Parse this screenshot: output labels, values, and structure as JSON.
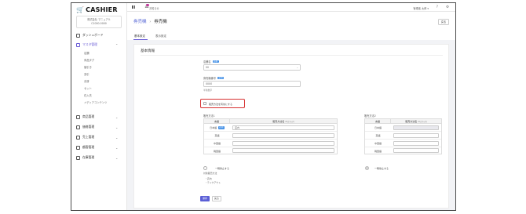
{
  "app": {
    "logo": "CASHIER",
    "logo_mark": "🛒"
  },
  "store": {
    "name": "株式会社 マニュアル",
    "code": "C1000-0000"
  },
  "sidebar": {
    "dashboard": "ダッシュボード",
    "master": "マスタ管理",
    "master_items": [
      "店舗",
      "商品タグ",
      "値引き",
      "割引",
      "決済",
      "セット",
      "在入先",
      "メディアコンテンツ"
    ],
    "bottom_items": [
      "商品管理",
      "価格管理",
      "売上管理",
      "顧客管理",
      "在庫管理"
    ]
  },
  "header": {
    "notification_label": "お知らせ",
    "user": "管理者 太郎 ▾",
    "help_icon": "?",
    "gear_icon": "⚙"
  },
  "breadcrumb": {
    "parent": "券売機",
    "separator": "›",
    "current": "券売機"
  },
  "back_button": "戻る",
  "tabs": [
    "基本設定",
    "表示設定"
  ],
  "form": {
    "section_title": "基本情報",
    "required_badge": "必須",
    "store_label": "店舗名",
    "store_value": "00",
    "ticket_label": "券売機番号",
    "ticket_value": "0000",
    "ticket_hint": "半角数字",
    "checkbox_label": "販売方法を有効にする",
    "table1": {
      "title": "販売方法1",
      "head_lang": "言語",
      "head_name": "販売方法名",
      "head_sub": "20文字以内",
      "rows": [
        {
          "lang": "日本語",
          "required": true,
          "value": "店内"
        },
        {
          "lang": "英語",
          "required": false,
          "value": ""
        },
        {
          "lang": "中国語",
          "required": false,
          "value": ""
        },
        {
          "lang": "韓国語",
          "required": false,
          "value": ""
        }
      ]
    },
    "table2": {
      "title": "販売方法2",
      "head_lang": "言語",
      "head_name": "販売方法名",
      "head_sub": "20文字以内",
      "rows": [
        {
          "lang": "日本語",
          "value": ""
        },
        {
          "lang": "英語",
          "value": ""
        },
        {
          "lang": "中国語",
          "value": ""
        },
        {
          "lang": "韓国語",
          "value": ""
        }
      ]
    },
    "radio1": "一時停止する",
    "radio2": "一時停止する",
    "note_title": "対象販売方法",
    "note_items": [
      "・店内",
      "・テイクアウト"
    ],
    "save_button": "保存",
    "cancel_button": "戻る"
  },
  "colors": {
    "accent": "#6a5cd6",
    "link": "#5a6ad6",
    "highlight": "#d63030",
    "required": "#3f8ee6"
  }
}
